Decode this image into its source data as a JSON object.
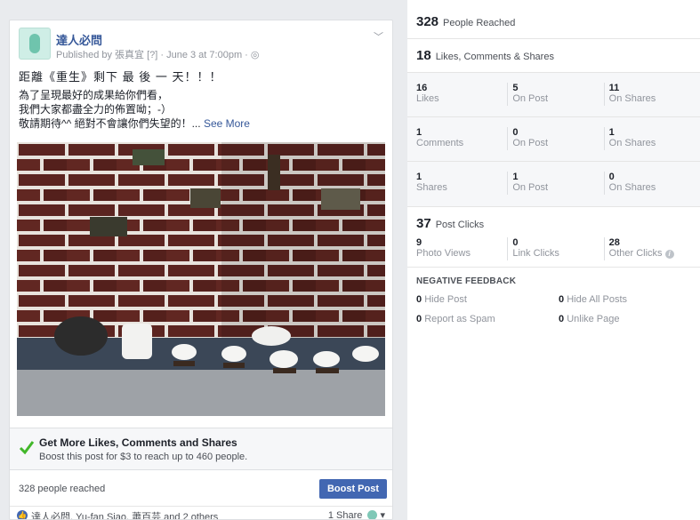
{
  "post": {
    "page_name": "達人必問",
    "meta": "Published by 張真宜 [?] · June 3 at 7:00pm · ",
    "globe_icon": "globe-icon",
    "line1": "距離《重生》剩下 最 後 一 天！！！",
    "line2": "為了呈現最好的成果給你們看，",
    "line3": "我們大家都盡全力的佈置呦；-）",
    "line4": "敬請期待^^ 絕對不會讓你們失望的！...",
    "see_more": "See More",
    "boost": {
      "title": "Get More Likes, Comments and Shares",
      "subtitle": "Boost this post for $3 to reach up to 460 people."
    },
    "reached": "328 people reached",
    "boost_button": "Boost Post",
    "likers": "達人必問, Yu-fan Siao, 蕭百芸 and 2 others",
    "shares": "1 Share"
  },
  "insights": {
    "reach": {
      "value": "328",
      "label": "People Reached"
    },
    "engagement": {
      "value": "18",
      "label": "Likes, Comments & Shares"
    },
    "grid": [
      [
        {
          "num": "16",
          "cap": "Likes"
        },
        {
          "num": "5",
          "cap": "On Post"
        },
        {
          "num": "11",
          "cap": "On Shares"
        }
      ],
      [
        {
          "num": "1",
          "cap": "Comments"
        },
        {
          "num": "0",
          "cap": "On Post"
        },
        {
          "num": "1",
          "cap": "On Shares"
        }
      ],
      [
        {
          "num": "1",
          "cap": "Shares"
        },
        {
          "num": "1",
          "cap": "On Post"
        },
        {
          "num": "0",
          "cap": "On Shares"
        }
      ]
    ],
    "clicks": {
      "value": "37",
      "label": "Post Clicks"
    },
    "click_breakdown": [
      {
        "num": "9",
        "cap": "Photo Views"
      },
      {
        "num": "0",
        "cap": "Link Clicks"
      },
      {
        "num": "28",
        "cap": "Other Clicks"
      }
    ],
    "negative": {
      "title": "NEGATIVE FEEDBACK",
      "items": [
        {
          "num": "0",
          "label": "Hide Post"
        },
        {
          "num": "0",
          "label": "Hide All Posts"
        },
        {
          "num": "0",
          "label": "Report as Spam"
        },
        {
          "num": "0",
          "label": "Unlike Page"
        }
      ]
    }
  },
  "colors": {
    "link": "#365899",
    "button": "#4267b2",
    "check": "#42b72a"
  }
}
